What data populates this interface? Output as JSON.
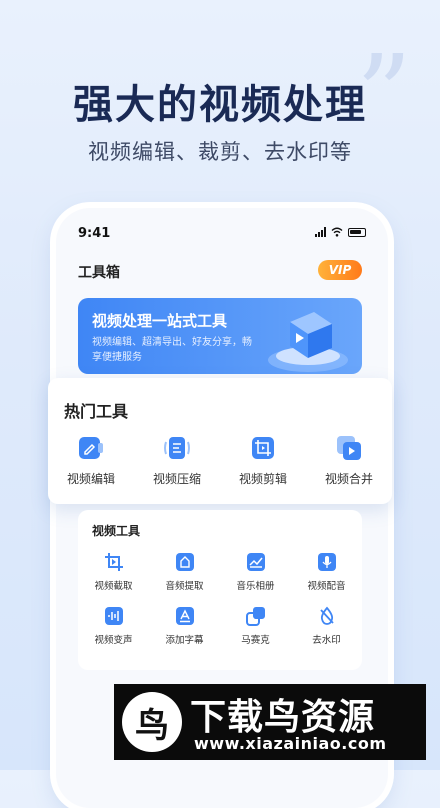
{
  "promo": {
    "headline": "强大的视频处理",
    "subhead": "视频编辑、裁剪、去水印等"
  },
  "status_bar": {
    "time": "9:41"
  },
  "app": {
    "title": "工具箱",
    "vip_label": "VIP"
  },
  "banner": {
    "title": "视频处理一站式工具",
    "description": "视频编辑、超清导出、好友分享，畅享便捷服务"
  },
  "hot_tools": {
    "title": "热门工具",
    "items": [
      {
        "label": "视频编辑",
        "icon": "edit-pen-icon"
      },
      {
        "label": "视频压缩",
        "icon": "compress-icon"
      },
      {
        "label": "视频剪辑",
        "icon": "crop-clip-icon"
      },
      {
        "label": "视频合并",
        "icon": "merge-icon"
      }
    ]
  },
  "video_tools": {
    "title": "视频工具",
    "items": [
      {
        "label": "视频截取",
        "icon": "crop-icon"
      },
      {
        "label": "音频提取",
        "icon": "audio-extract-icon"
      },
      {
        "label": "音乐相册",
        "icon": "photo-album-icon"
      },
      {
        "label": "视频配音",
        "icon": "microphone-icon"
      },
      {
        "label": "视频变声",
        "icon": "voice-change-icon"
      },
      {
        "label": "添加字幕",
        "icon": "subtitle-icon"
      },
      {
        "label": "马赛克",
        "icon": "mosaic-icon"
      },
      {
        "label": "去水印",
        "icon": "remove-watermark-icon"
      }
    ]
  },
  "watermark": {
    "logo_char": "鸟",
    "title": "下载鸟资源",
    "url": "www.xiazainiao.com"
  },
  "colors": {
    "accent": "#3f86f5",
    "accent_light": "#6aa6fb",
    "vip": "#ff8a1e",
    "headline": "#1a2a55"
  }
}
